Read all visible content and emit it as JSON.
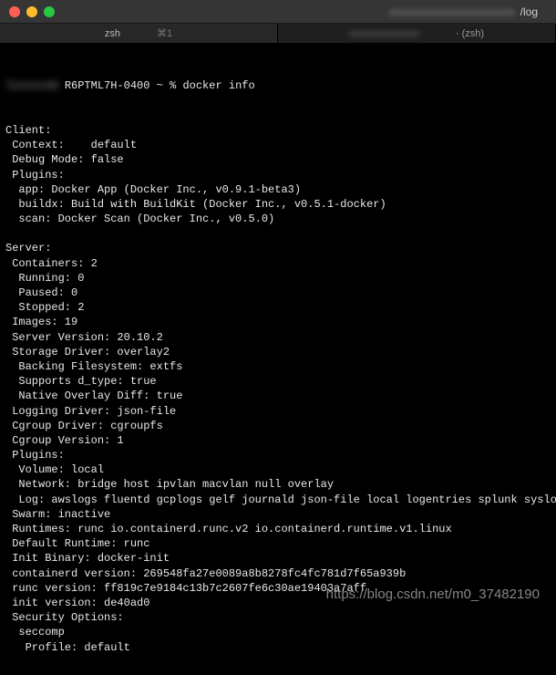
{
  "titlebar": {
    "title_suffix": "/log"
  },
  "tabs": {
    "tab1_label": "zsh",
    "tab1_shortcut": "⌘1",
    "tab2_suffix": " · (zsh)"
  },
  "prompt": {
    "host_suffix": "R6PTML7H-0400",
    "path": "~",
    "sep": "%",
    "command": "docker info"
  },
  "output_lines": [
    "Client:",
    " Context:    default",
    " Debug Mode: false",
    " Plugins:",
    "  app: Docker App (Docker Inc., v0.9.1-beta3)",
    "  buildx: Build with BuildKit (Docker Inc., v0.5.1-docker)",
    "  scan: Docker Scan (Docker Inc., v0.5.0)",
    "",
    "Server:",
    " Containers: 2",
    "  Running: 0",
    "  Paused: 0",
    "  Stopped: 2",
    " Images: 19",
    " Server Version: 20.10.2",
    " Storage Driver: overlay2",
    "  Backing Filesystem: extfs",
    "  Supports d_type: true",
    "  Native Overlay Diff: true",
    " Logging Driver: json-file",
    " Cgroup Driver: cgroupfs",
    " Cgroup Version: 1",
    " Plugins:",
    "  Volume: local",
    "  Network: bridge host ipvlan macvlan null overlay",
    "  Log: awslogs fluentd gcplogs gelf journald json-file local logentries splunk syslog",
    " Swarm: inactive",
    " Runtimes: runc io.containerd.runc.v2 io.containerd.runtime.v1.linux",
    " Default Runtime: runc",
    " Init Binary: docker-init",
    " containerd version: 269548fa27e0089a8b8278fc4fc781d7f65a939b",
    " runc version: ff819c7e9184c13b7c2607fe6c30ae19403a7aff",
    " init version: de40ad0",
    " Security Options:",
    "  seccomp",
    "   Profile: default"
  ],
  "watermark": "https://blog.csdn.net/m0_37482190"
}
